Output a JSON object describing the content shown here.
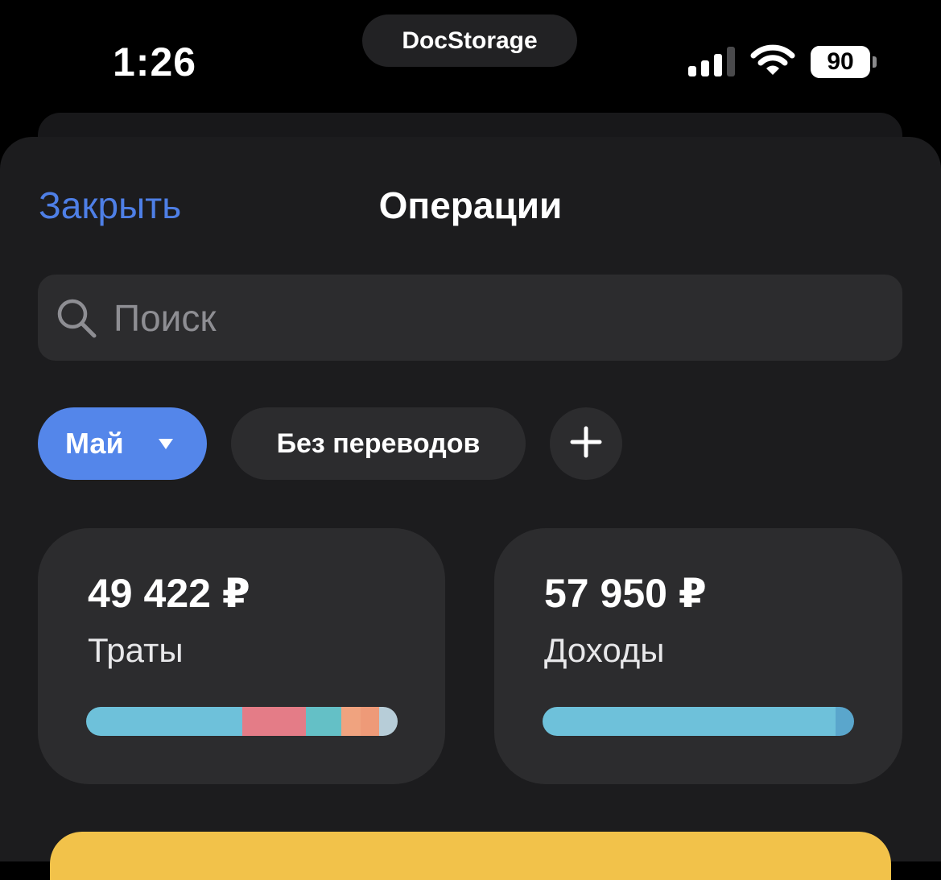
{
  "status_bar": {
    "time": "1:26",
    "app_pill": "DocStorage",
    "battery": "90"
  },
  "header": {
    "close_label": "Закрыть",
    "title": "Операции"
  },
  "search": {
    "placeholder": "Поиск",
    "value": ""
  },
  "filters": {
    "month_label": "Май",
    "transfers_label": "Без переводов"
  },
  "summary": {
    "spending": {
      "amount": "49 422 ₽",
      "label": "Траты",
      "breakdown": [
        {
          "share": 0.5,
          "color": "#6ec1da"
        },
        {
          "share": 0.205,
          "color": "#e47c87"
        },
        {
          "share": 0.115,
          "color": "#64c0c6"
        },
        {
          "share": 0.06,
          "color": "#f0a37f"
        },
        {
          "share": 0.06,
          "color": "#ee9a78"
        },
        {
          "share": 0.06,
          "color": "#b7cdd8"
        }
      ]
    },
    "income": {
      "amount": "57 950 ₽",
      "label": "Доходы",
      "breakdown": [
        {
          "share": 0.94,
          "color": "#6ec1da"
        },
        {
          "share": 0.06,
          "color": "#5aa6cc"
        }
      ]
    }
  },
  "colors": {
    "accent": "#5486ea",
    "link": "#4e7fe6",
    "surface": "#2c2c2e",
    "sheet": "#1c1c1e"
  }
}
